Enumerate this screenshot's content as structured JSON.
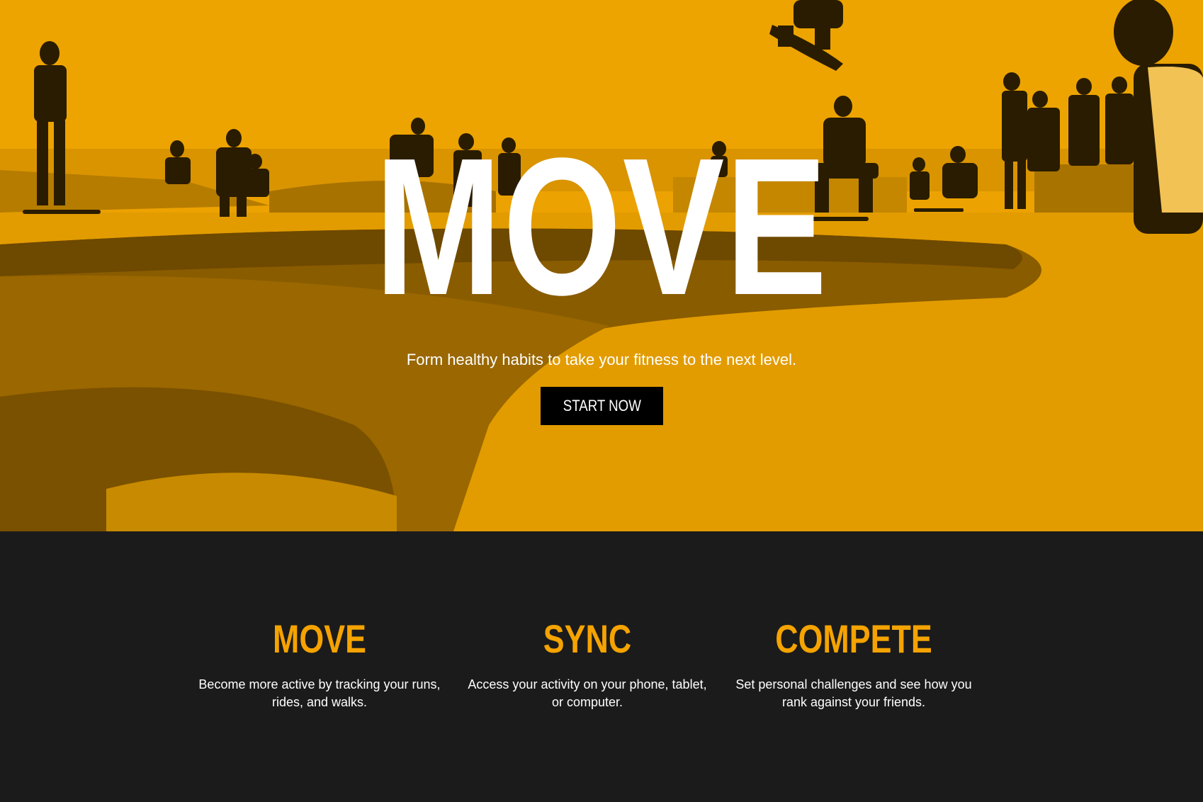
{
  "colors": {
    "hero_background": "#eca200",
    "dark_background": "#1b1b1b",
    "accent": "#f5a300",
    "button": "#000000",
    "text_light": "#ffffff"
  },
  "hero": {
    "title": "MOVE",
    "subtitle": "Form healthy habits to take your fitness to the next level.",
    "cta_label": "START NOW"
  },
  "features": [
    {
      "title": "MOVE",
      "text": "Become more active by tracking your runs, rides, and walks."
    },
    {
      "title": "SYNC",
      "text": "Access your activity on your phone, tablet, or computer."
    },
    {
      "title": "COMPETE",
      "text": "Set personal challenges and see how you rank against your friends."
    }
  ]
}
